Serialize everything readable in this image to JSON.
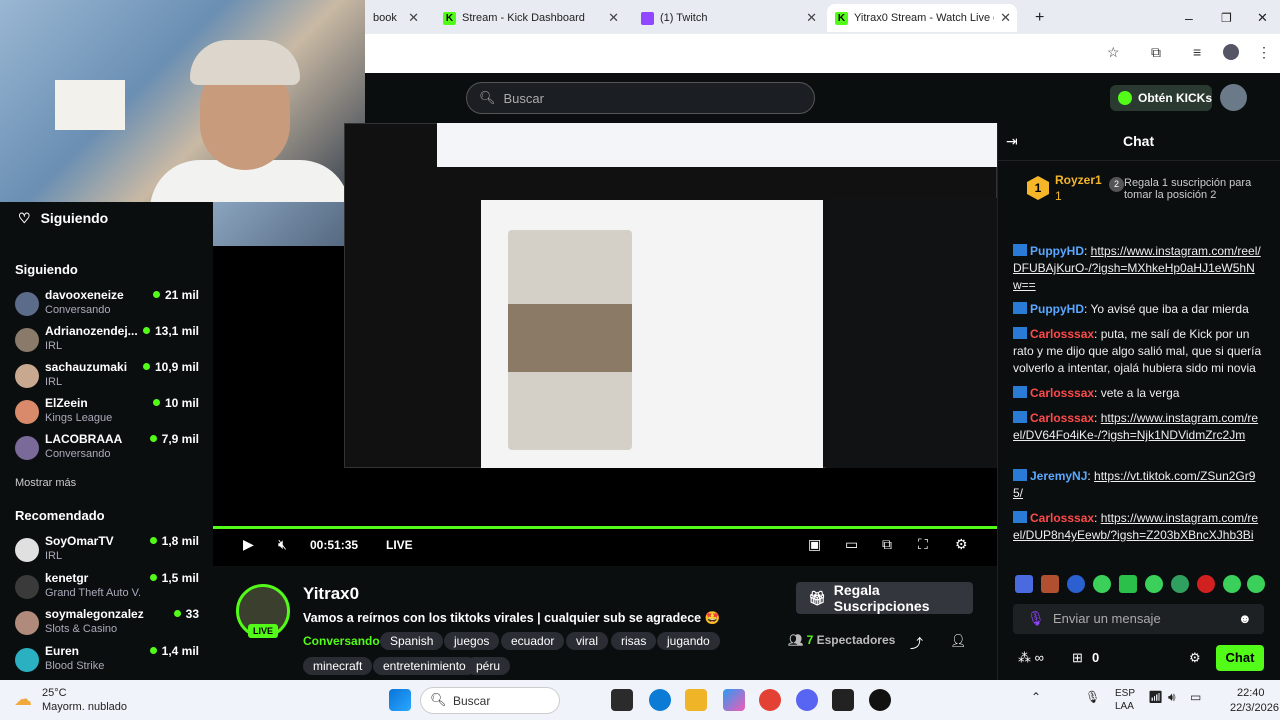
{
  "browser": {
    "tabs": [
      {
        "label": "book"
      },
      {
        "label": "Stream - Kick Dashboard"
      },
      {
        "label": "(1) Twitch"
      },
      {
        "label": "Yitrax0 Stream - Watch Live on"
      }
    ]
  },
  "header": {
    "search_placeholder": "Buscar",
    "get_kicks": "Obtén KICKs"
  },
  "sidebar": {
    "following_heading": "Siguiendo",
    "following_label": "Siguiendo",
    "following": [
      {
        "name": "davooxeneize",
        "category": "Conversando",
        "viewers": "21 mil"
      },
      {
        "name": "Adrianozendej...",
        "category": "IRL",
        "viewers": "13,1 mil"
      },
      {
        "name": "sachauzumaki",
        "category": "IRL",
        "viewers": "10,9 mil"
      },
      {
        "name": "ElZeein",
        "category": "Kings League",
        "viewers": "10 mil"
      },
      {
        "name": "LACOBRAAA",
        "category": "Conversando",
        "viewers": "7,9 mil"
      }
    ],
    "show_more": "Mostrar más",
    "recommended_label": "Recomendado",
    "recommended": [
      {
        "name": "SoyOmarTV",
        "category": "IRL",
        "viewers": "1,8 mil"
      },
      {
        "name": "kenetgr",
        "category": "Grand Theft Auto V...",
        "viewers": "1,5 mil"
      },
      {
        "name": "soymalegonzalez",
        "category": "Slots & Casino",
        "viewers": "33"
      },
      {
        "name": "Euren",
        "category": "Blood Strike",
        "viewers": "1,4 mil"
      }
    ]
  },
  "player": {
    "time": "00:51:35",
    "live": "LIVE"
  },
  "stream": {
    "channel": "Yitrax0",
    "title": "Vamos a reírnos con los tiktoks virales | cualquier sub se agradece 🤩",
    "category": "Conversando",
    "tags": [
      "Spanish",
      "juegos",
      "ecuador",
      "viral",
      "risas",
      "jugando",
      "minecraft",
      "entretenimiento",
      "péru"
    ],
    "live_badge": "LIVE",
    "gift_button": "Regala Suscripciones",
    "viewers_count": "7",
    "viewers_label": "Espectadores"
  },
  "chat": {
    "title": "Chat",
    "top_donor": "Royzer1",
    "top_donor_count": "1",
    "gift_prompt": "Regala 1 suscripción para tomar la posición 2",
    "messages": [
      {
        "user": "PuppyHD",
        "color": "blue",
        "text": "https://www.instagram.com/reel/DFUBAjKurO-/?igsh=MXhkeHp0aHJ1eW5hNw==",
        "link": true
      },
      {
        "user": "PuppyHD",
        "color": "blue",
        "text": "Yo avisé que iba a dar mierda",
        "link": false
      },
      {
        "user": "Carlosssax",
        "color": "red",
        "text": "puta, me salí de Kick por un rato y me dijo que algo salió mal, que si quería volverlo a intentar, ojalá hubiera sido mi novia",
        "link": false
      },
      {
        "user": "Carlosssax",
        "color": "red",
        "text": "vete a la verga",
        "link": false
      },
      {
        "user": "Carlosssax",
        "color": "red",
        "text": "https://www.instagram.com/reel/DV64Fo4iKe-/?igsh=Njk1NDVidmZrc2Jm",
        "link": true
      },
      {
        "user": "JeremyNJ",
        "color": "blue",
        "text": "https://vt.tiktok.com/ZSun2Gr95/",
        "link": true
      },
      {
        "user": "Carlosssax",
        "color": "red",
        "text": "https://www.instagram.com/reel/DUP8n4yEewb/?igsh=Z203bXBncXJhb3Bi",
        "link": true
      }
    ],
    "input_placeholder": "Enviar un mensaje",
    "points": "0",
    "send_button": "Chat"
  },
  "taskbar": {
    "temp": "25°C",
    "weather": "Mayorm. nublado",
    "search": "Buscar",
    "lang1": "ESP",
    "lang2": "LAA",
    "time": "22:40",
    "date": "22/3/2026"
  },
  "colors": {
    "accent": "#53fc18",
    "bg": "#0b0e0f",
    "chat_blue": "#5aa8ff",
    "chat_red": "#ff4a4a"
  }
}
